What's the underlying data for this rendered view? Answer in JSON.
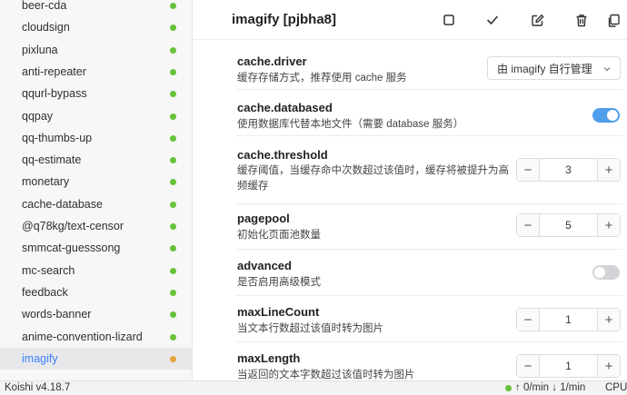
{
  "sidebar": {
    "items": [
      {
        "label": "beer-cda",
        "status": "running"
      },
      {
        "label": "cloudsign",
        "status": "running"
      },
      {
        "label": "pixluna",
        "status": "running"
      },
      {
        "label": "anti-repeater",
        "status": "running"
      },
      {
        "label": "qqurl-bypass",
        "status": "running"
      },
      {
        "label": "qqpay",
        "status": "running"
      },
      {
        "label": "qq-thumbs-up",
        "status": "running"
      },
      {
        "label": "qq-estimate",
        "status": "running"
      },
      {
        "label": "monetary",
        "status": "running"
      },
      {
        "label": "cache-database",
        "status": "running"
      },
      {
        "label": "@q78kg/text-censor",
        "status": "running"
      },
      {
        "label": "smmcat-guesssong",
        "status": "running"
      },
      {
        "label": "mc-search",
        "status": "running"
      },
      {
        "label": "feedback",
        "status": "running"
      },
      {
        "label": "words-banner",
        "status": "running"
      },
      {
        "label": "anime-convention-lizard",
        "status": "running"
      },
      {
        "label": "imagify",
        "status": "modified",
        "active": true
      }
    ]
  },
  "header": {
    "title": "imagify [pjbha8]",
    "actions": [
      "stop-icon",
      "check-icon",
      "edit-icon",
      "trash-icon",
      "copy-icon"
    ]
  },
  "settings": {
    "driver": {
      "key": "cache.driver",
      "desc": "缓存存储方式，推荐使用 cache 服务",
      "value": "由 imagify 自行管理"
    },
    "databased": {
      "key": "cache.databased",
      "desc": "使用数据库代替本地文件（需要 database 服务）",
      "enabled": true
    },
    "threshold": {
      "key": "cache.threshold",
      "desc": "缓存阈值，当缓存命中次数超过该值时，缓存将被提升为高频缓存",
      "value": "3"
    },
    "pagepool": {
      "key": "pagepool",
      "desc": "初始化页面池数量",
      "value": "5"
    },
    "advanced": {
      "key": "advanced",
      "desc": "是否启用高级模式",
      "enabled": false
    },
    "maxLineCount": {
      "key": "maxLineCount",
      "desc": "当文本行数超过该值时转为图片",
      "value": "1"
    },
    "maxLength": {
      "key": "maxLength",
      "desc": "当返回的文本字数超过该值时转为图片",
      "value": "1"
    }
  },
  "stepper": {
    "minus": "−",
    "plus": "+"
  },
  "statusbar": {
    "version": "Koishi v4.18.7",
    "rate": "↑ 0/min ↓ 1/min",
    "cpu": "CPU:"
  },
  "colors": {
    "accent": "#3b82f6",
    "running": "#67c23a",
    "modified": "#e6a23c",
    "toggle_on": "#4f9dea"
  }
}
